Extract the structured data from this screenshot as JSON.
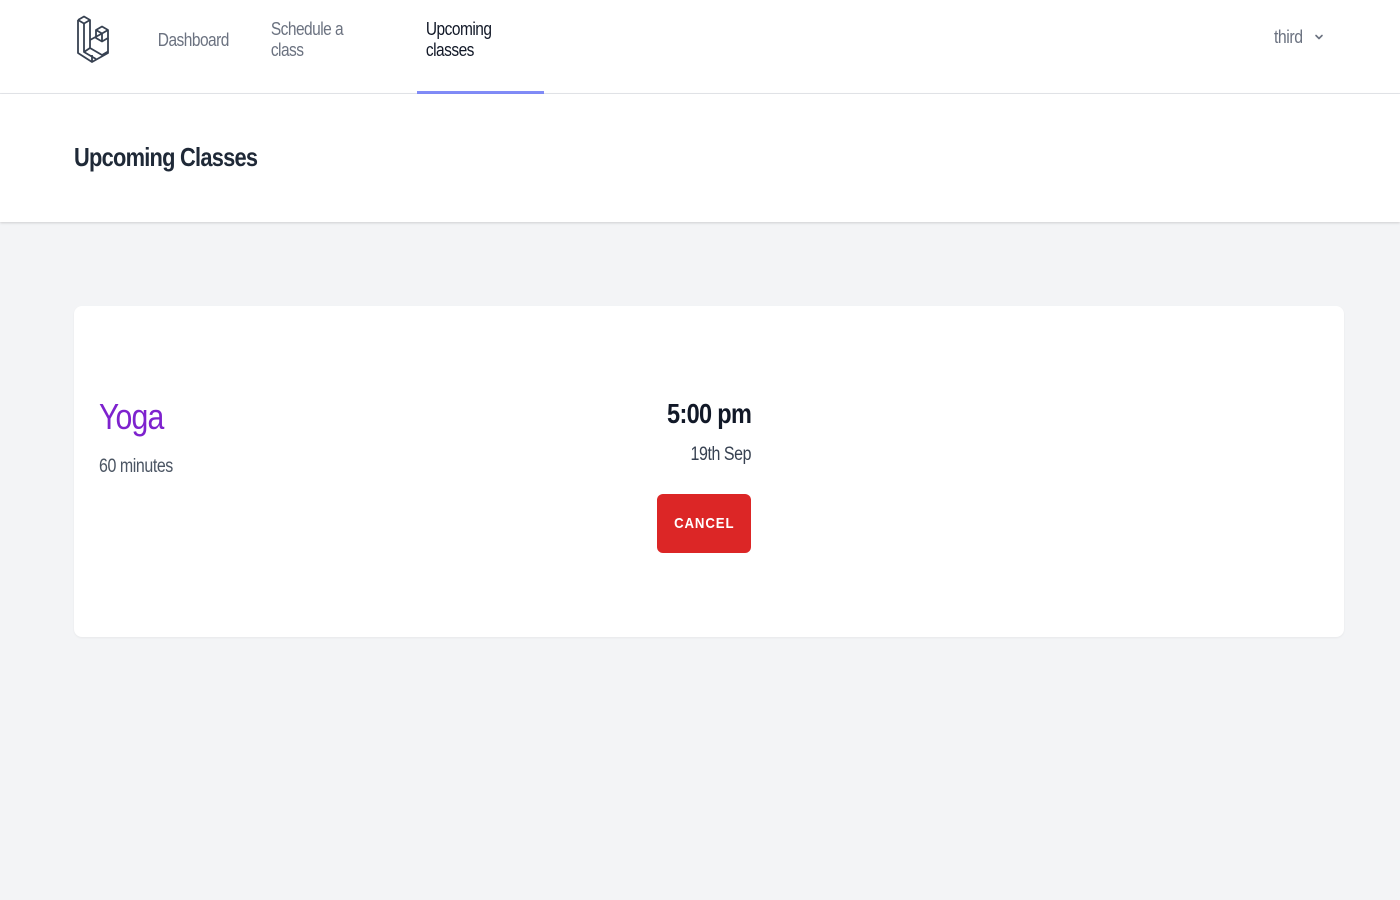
{
  "nav": {
    "logo_icon": "laravel-logo-icon",
    "links": [
      {
        "label": "Dashboard",
        "active": false
      },
      {
        "label": "Schedule a class",
        "active": false
      },
      {
        "label": "Upcoming classes",
        "active": true
      }
    ],
    "user": {
      "name": "third",
      "icon": "chevron-down-icon"
    }
  },
  "header": {
    "title": "Upcoming Classes"
  },
  "classes": [
    {
      "name": "Yoga",
      "duration": "60 minutes",
      "time": "5:00 pm",
      "date": "19th Sep",
      "cancel_label": "CANCEL"
    }
  ],
  "colors": {
    "accent": "#818cf8",
    "class_name": "#7e22ce",
    "cancel": "#dc2626",
    "background": "#f3f4f6"
  }
}
